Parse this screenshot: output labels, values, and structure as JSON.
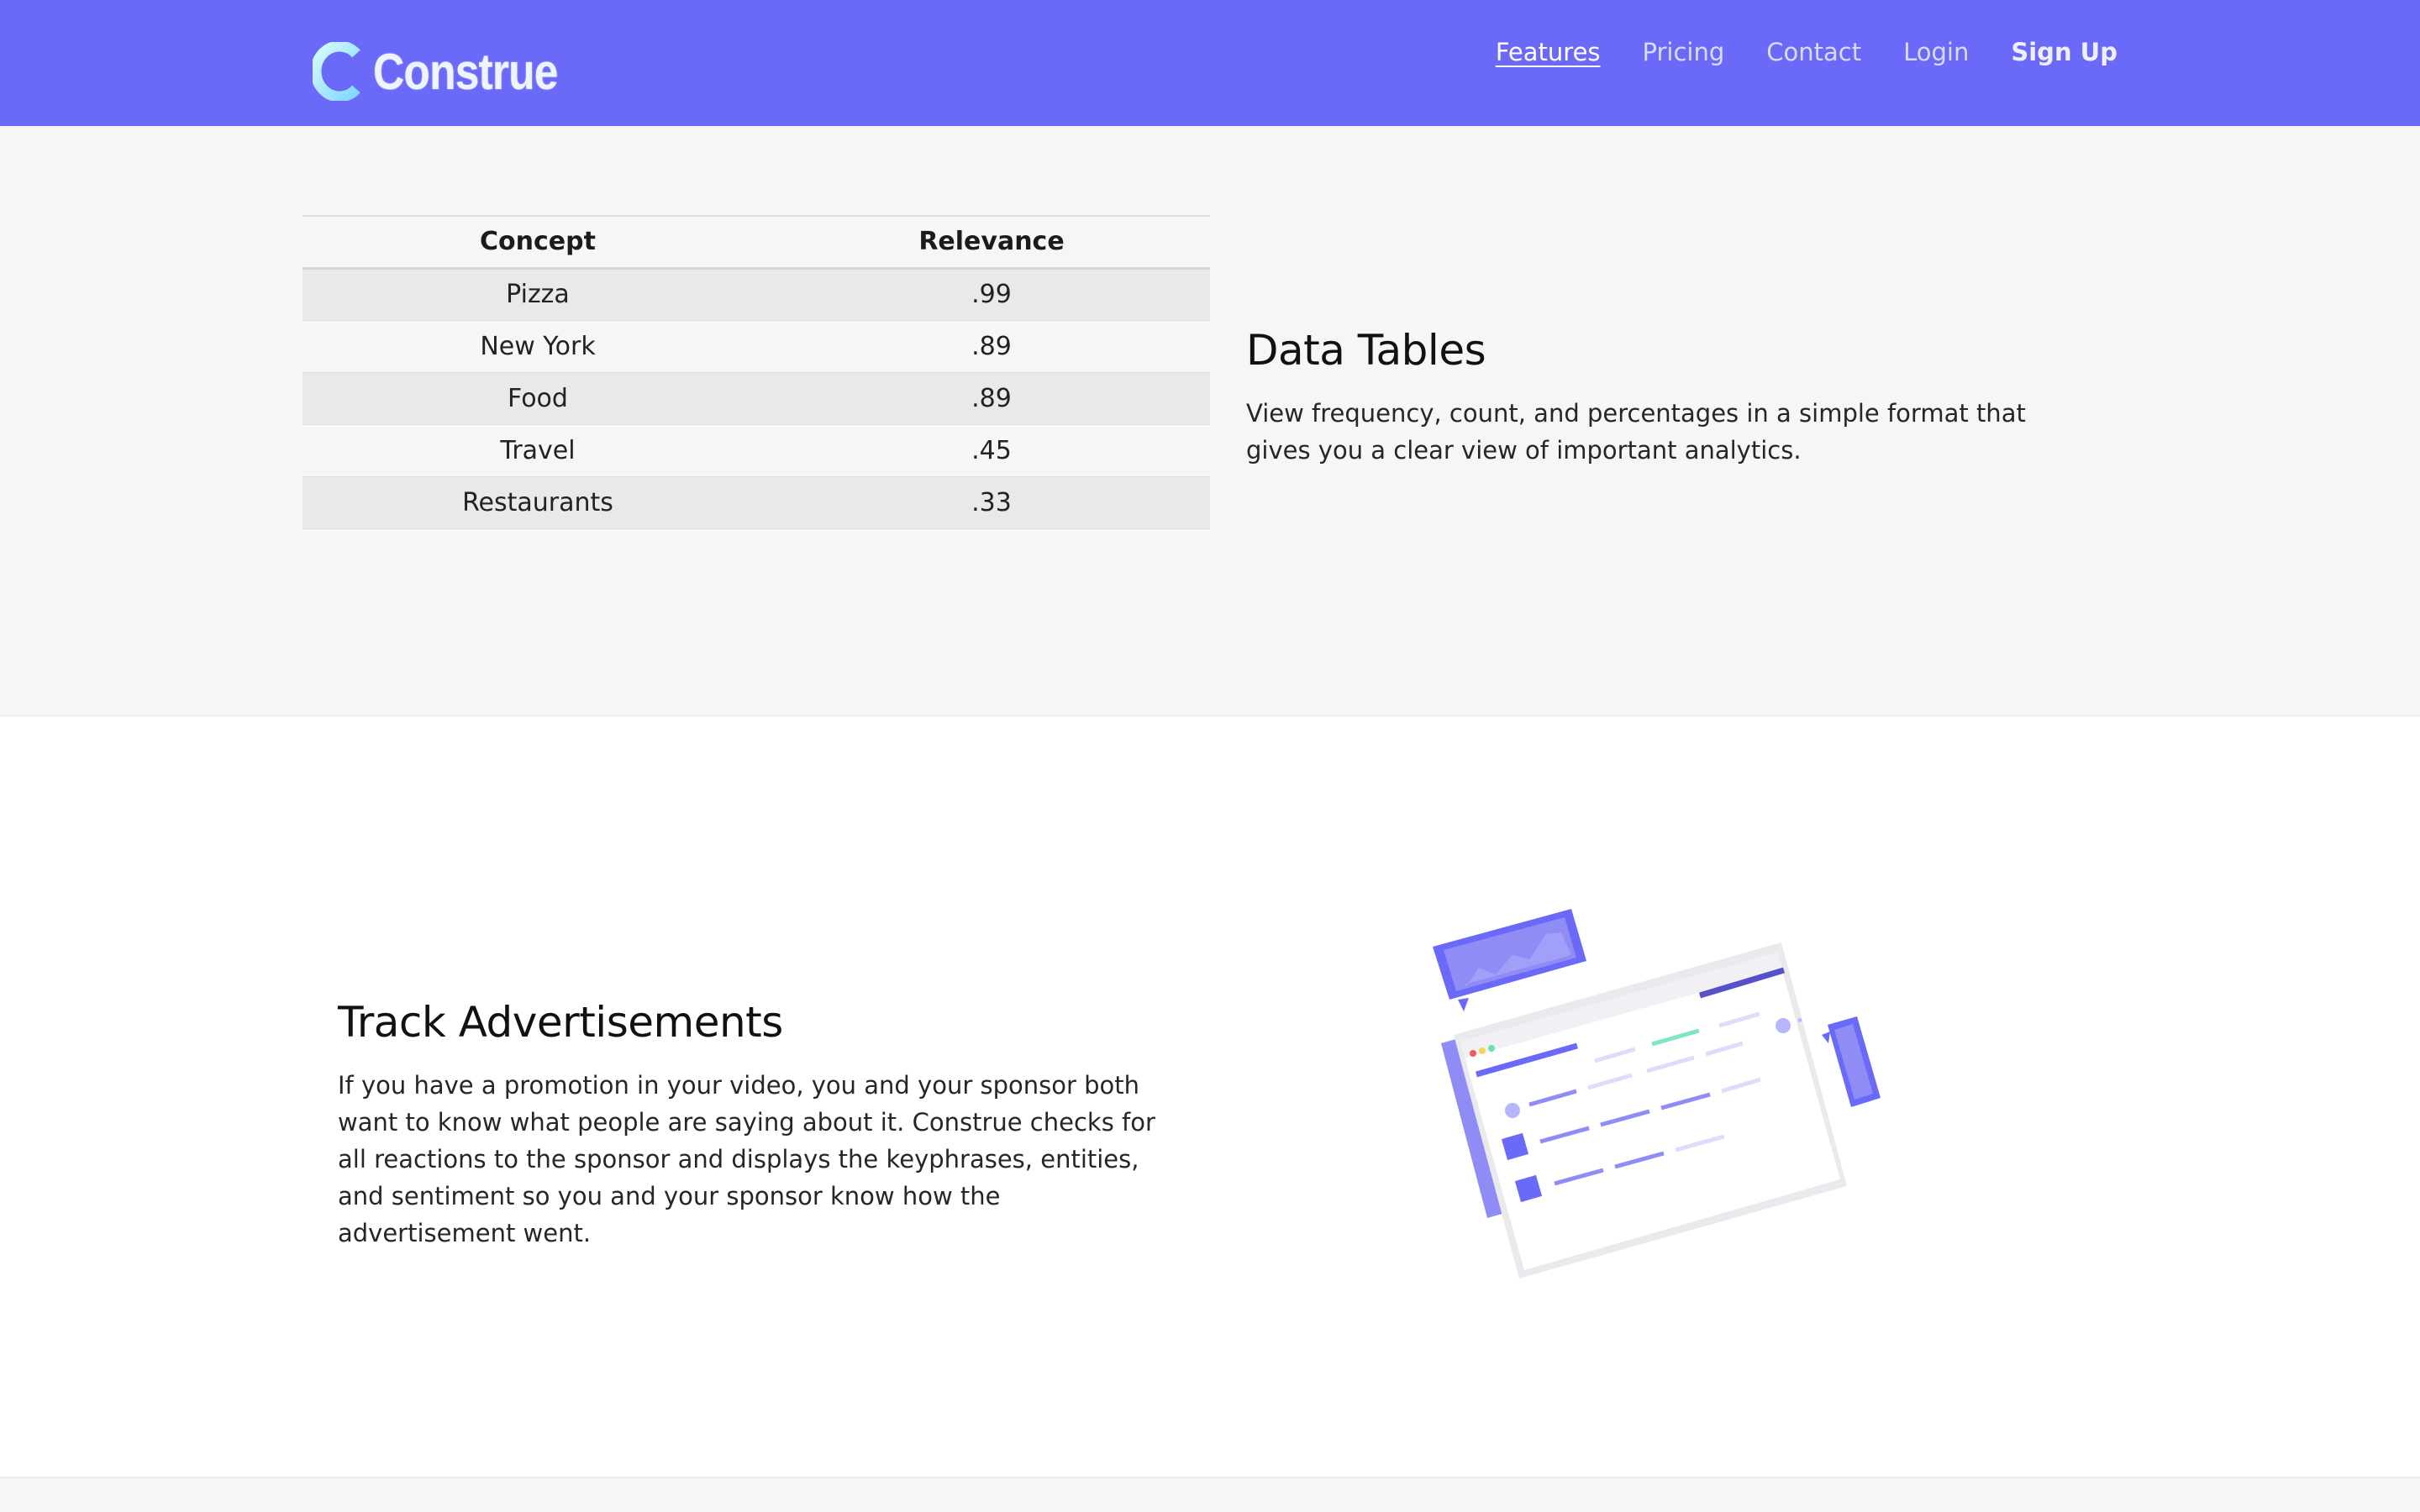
{
  "header": {
    "logo_text": "Construe",
    "nav": [
      {
        "label": "Features",
        "active": true
      },
      {
        "label": "Pricing"
      },
      {
        "label": "Contact"
      },
      {
        "label": "Login"
      },
      {
        "label": "Sign Up"
      }
    ]
  },
  "data_tables": {
    "columns": [
      "Concept",
      "Relevance"
    ],
    "rows": [
      {
        "concept": "Pizza",
        "relevance": ".99"
      },
      {
        "concept": "New York",
        "relevance": ".89"
      },
      {
        "concept": "Food",
        "relevance": ".89"
      },
      {
        "concept": "Travel",
        "relevance": ".45"
      },
      {
        "concept": "Restaurants",
        "relevance": ".33"
      }
    ],
    "title": "Data Tables",
    "description": "View frequency, count, and percentages in a simple format that gives you a clear view of important analytics."
  },
  "track_ads": {
    "title": "Track Advertisements",
    "description": "If you have a promotion in your video, you and your sponsor both want to know what people are saying about it. Construe checks for all reactions to the sponsor and displays the keyphrases, entities, and sentiment so you and your sponsor know how the advertisement went."
  },
  "colors": {
    "header_bg": "#6b69f7",
    "accent": "#6b69f7",
    "logo_gradient_start": "#c4f7ff",
    "logo_gradient_end": "#7fd6ff"
  }
}
